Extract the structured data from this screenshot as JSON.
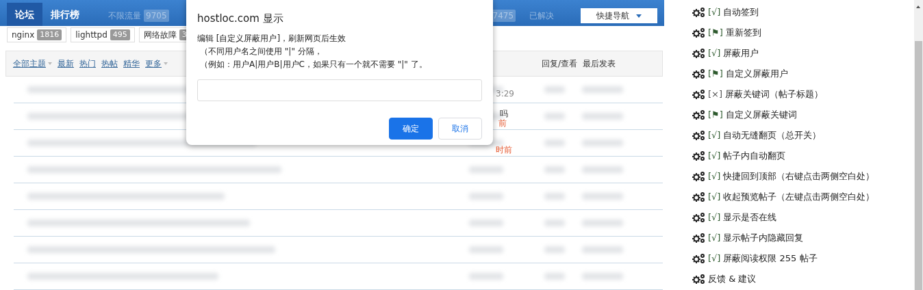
{
  "forum": {
    "tabs": [
      {
        "label": "论坛",
        "selected": true
      },
      {
        "label": "排行榜",
        "selected": false
      }
    ],
    "faded_tabs": [
      {
        "label": "不限流量",
        "count": "9705"
      },
      {
        "count": "7475"
      },
      {
        "label": "已解决"
      }
    ],
    "quick_nav": "快捷导航",
    "tags": [
      {
        "label": "nginx",
        "count": "1816"
      },
      {
        "label": "lighttpd",
        "count": "495"
      },
      {
        "label": "网络故障",
        "count": "3"
      }
    ],
    "filters": [
      {
        "label": "全部主题",
        "dropdown": true
      },
      {
        "label": "最新",
        "dropdown": false
      },
      {
        "label": "热门",
        "dropdown": false
      },
      {
        "label": "热帖",
        "dropdown": false
      },
      {
        "label": "精华",
        "dropdown": false
      },
      {
        "label": "更多",
        "dropdown": true
      }
    ],
    "columns": [
      "回复/查看",
      "最后发表"
    ],
    "rows": [
      {
        "fragment": "3:29",
        "kind": "time"
      },
      {
        "fragment": "吗",
        "sub": "前"
      },
      {
        "sub": "时前"
      },
      {},
      {},
      {},
      {},
      {}
    ]
  },
  "dialog": {
    "title": "hostloc.com 显示",
    "message": [
      "编辑 [自定义屏蔽用户]，刷新网页后生效",
      "（不同用户名之间使用 \"|\" 分隔，",
      "（例如：用户A|用户B|用户C，如果只有一个就不需要 \"|\" 了。"
    ],
    "buttons": [
      {
        "label": "确定",
        "kind": "primary"
      },
      {
        "label": "取消",
        "kind": "secondary"
      }
    ]
  },
  "menu": {
    "items": [
      {
        "tag": "[√]",
        "kind": "on",
        "label": "自动签到"
      },
      {
        "tag": "[⚑]",
        "kind": "flag",
        "label": "重新签到"
      },
      {
        "tag": "[√]",
        "kind": "on",
        "label": "屏蔽用户"
      },
      {
        "tag": "[⚑]",
        "kind": "flag",
        "label": "自定义屏蔽用户"
      },
      {
        "tag": "[×]",
        "kind": "off",
        "label": "屏蔽关键词（帖子标题）"
      },
      {
        "tag": "[⚑]",
        "kind": "flag",
        "label": "自定义屏蔽关键词"
      },
      {
        "tag": "[√]",
        "kind": "on",
        "label": "自动无缝翻页（总开关）"
      },
      {
        "tag": "[√]",
        "kind": "on",
        "label": "帖子内自动翻页"
      },
      {
        "tag": "[√]",
        "kind": "on",
        "label": "快捷回到顶部（右键点击两侧空白处）"
      },
      {
        "tag": "[√]",
        "kind": "on",
        "label": "收起预览帖子（左键点击两侧空白处）"
      },
      {
        "tag": "[√]",
        "kind": "on",
        "label": "显示是否在线"
      },
      {
        "tag": "[√]",
        "kind": "on",
        "label": "显示帖子内隐藏回复"
      },
      {
        "tag": "[√]",
        "kind": "on",
        "label": "屏蔽阅读权限 255 帖子"
      },
      {
        "kind": "plain",
        "label": "反馈 & 建议"
      }
    ]
  }
}
